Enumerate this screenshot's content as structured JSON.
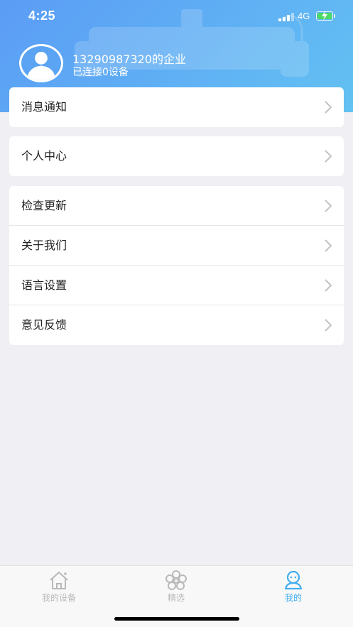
{
  "status_bar": {
    "time": "4:25",
    "network": "4G"
  },
  "profile": {
    "name": "13290987320的企业",
    "status": "已连接0设备"
  },
  "menu": {
    "notifications": "消息通知",
    "personal_center": "个人中心",
    "check_updates": "检查更新",
    "about_us": "关于我们",
    "language_settings": "语言设置",
    "feedback": "意见反馈"
  },
  "tabs": [
    {
      "label": "我的设备",
      "icon": "home-icon",
      "active": false
    },
    {
      "label": "精选",
      "icon": "flower-icon",
      "active": false
    },
    {
      "label": "我的",
      "icon": "user-icon",
      "active": true
    }
  ],
  "colors": {
    "header_start": "#5b9cf5",
    "header_end": "#63c2f2",
    "tab_active": "#41aef0",
    "tab_inactive": "#b9b9b9",
    "battery_fill": "#4cd964"
  }
}
